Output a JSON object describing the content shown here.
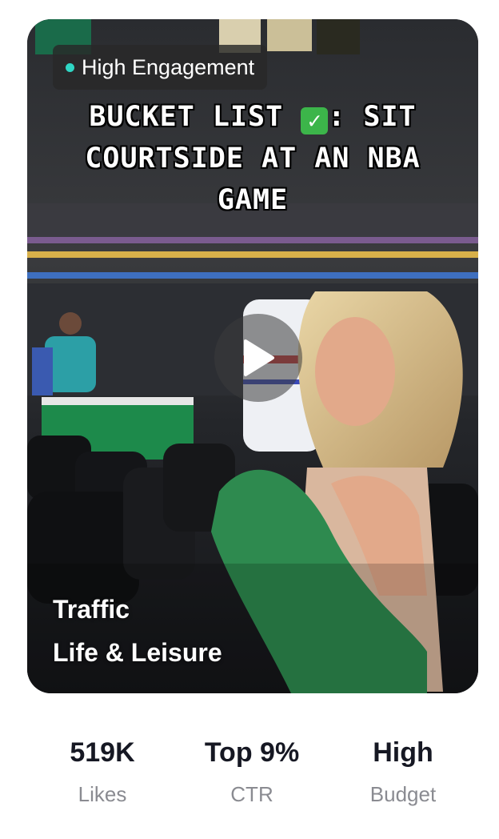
{
  "video": {
    "badge_label": "High Engagement",
    "caption_part1": "BUCKET LIST ",
    "caption_part2": ": SIT COURTSIDE AT AN NBA GAME",
    "category_primary": "Traffic",
    "category_secondary": "Life & Leisure",
    "accent_color": "#2fd6c4"
  },
  "stats": [
    {
      "value": "519K",
      "label": "Likes"
    },
    {
      "value": "Top 9%",
      "label": "CTR"
    },
    {
      "value": "High",
      "label": "Budget"
    }
  ]
}
